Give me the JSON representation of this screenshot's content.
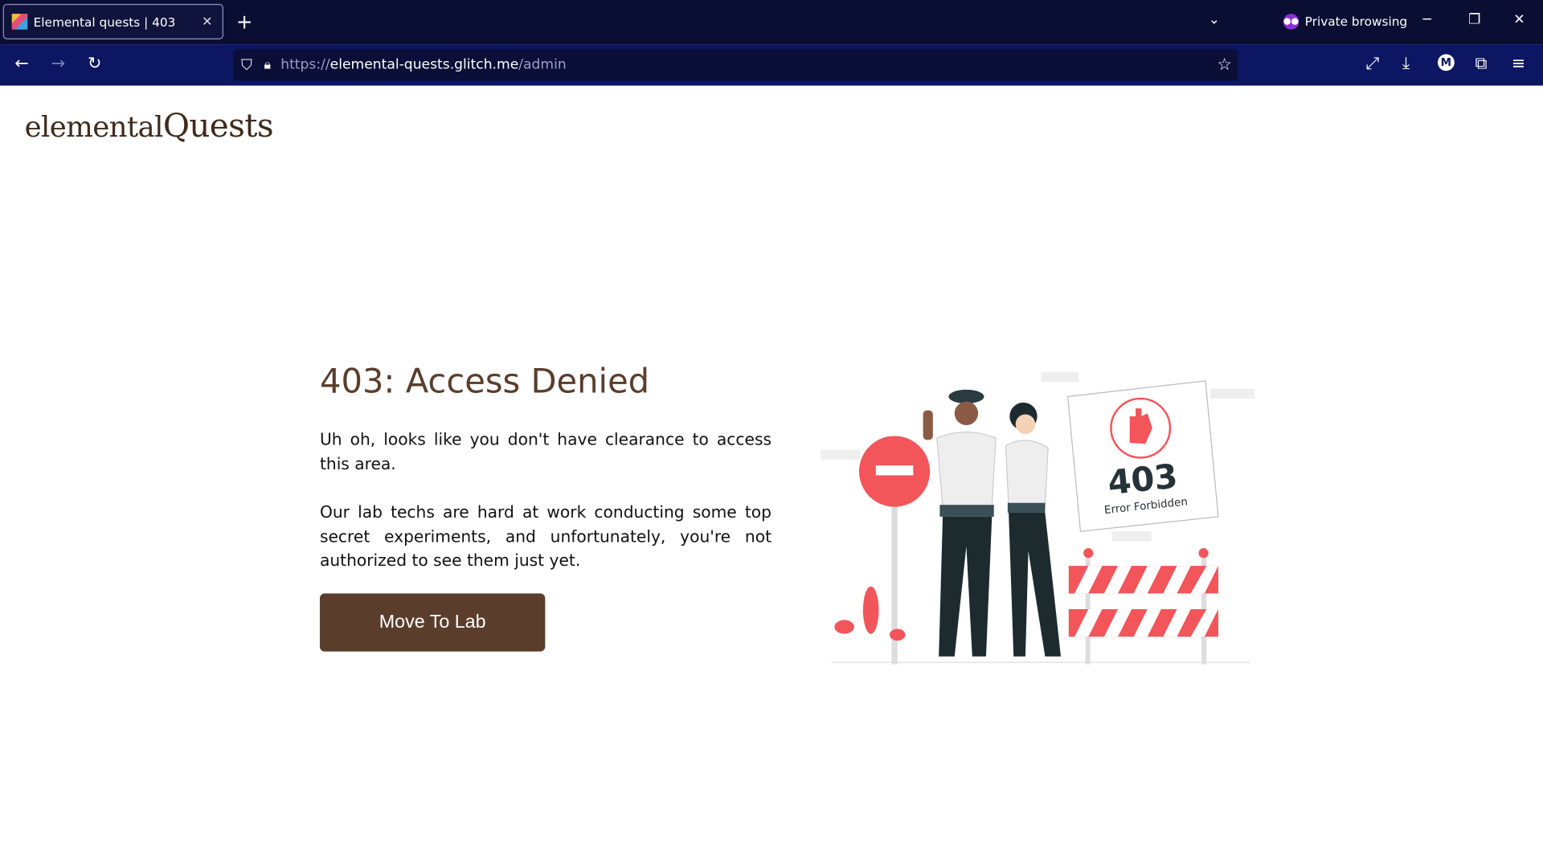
{
  "browser": {
    "tab_title": "Elemental quests | 403",
    "private_label": "Private browsing",
    "url_scheme": "https://",
    "url_host": "elemental-quests.glitch.me",
    "url_path": "/admin"
  },
  "page": {
    "logo_part1": "elemental",
    "logo_part2": "Quests",
    "heading": "403: Access Denied",
    "para1": "Uh oh, looks like you don't have clearance to access this area.",
    "para2": "Our lab techs are hard at work conducting some top secret experiments, and unfortunately, you're not authorized to see them just yet.",
    "button_label": "Move To Lab",
    "illustration": {
      "code": "403",
      "caption": "Error Forbidden"
    }
  },
  "colors": {
    "brand": "#5a3e2b",
    "accent": "#f2555a",
    "tabbar": "#0b0e33",
    "navbar": "#0c1663"
  }
}
